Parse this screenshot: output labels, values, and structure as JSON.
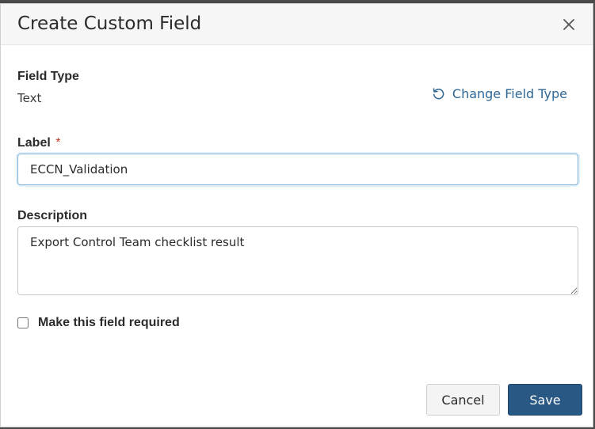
{
  "dialog": {
    "title": "Create Custom Field"
  },
  "field_type": {
    "label": "Field Type",
    "value": "Text",
    "change_link": "Change Field Type"
  },
  "label_field": {
    "label": "Label",
    "required_marker": "*",
    "value": "ECCN_Validation"
  },
  "description_field": {
    "label": "Description",
    "value": "Export Control Team checklist result"
  },
  "required_checkbox": {
    "label": "Make this field required",
    "checked": false
  },
  "buttons": {
    "cancel": "Cancel",
    "save": "Save"
  },
  "icons": {
    "close": "close-icon",
    "change_type": "rotate-ccw-icon"
  },
  "colors": {
    "primary": "#2a5885",
    "link": "#2f6796",
    "required": "#c0392b",
    "focus_border": "#7fb2db"
  }
}
